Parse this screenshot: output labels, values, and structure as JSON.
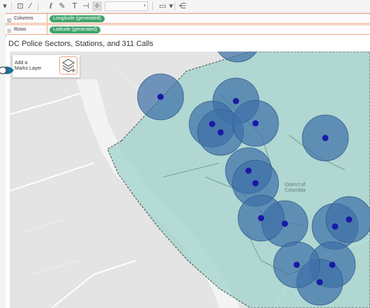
{
  "toolbar": {
    "icons": [
      "fit-icon",
      "tooltip-icon",
      "annotation-icon",
      "format-icon",
      "text-label-icon",
      "pin-icon",
      "show-cards-icon",
      "presentation-icon",
      "share-icon"
    ],
    "dropdown_value": ""
  },
  "shelves": {
    "columns": {
      "label": "Columns",
      "pill": "Longitude (generated)"
    },
    "rows": {
      "label": "Rows",
      "pill": "Latitude (generated)"
    }
  },
  "viz": {
    "title": "DC Police Sectors, Stations, and 311 Calls",
    "marks_layer_label": "Add a\nMarks Layer",
    "map_label": "District of\nColumbia",
    "colors": {
      "boundary_fill": "#9fd3cb",
      "circle_fill": "#3d6fa8",
      "dot_fill": "#1a1aa6",
      "pill": "#3fa36a",
      "accent": "#f0a885"
    },
    "station_count": 16
  }
}
